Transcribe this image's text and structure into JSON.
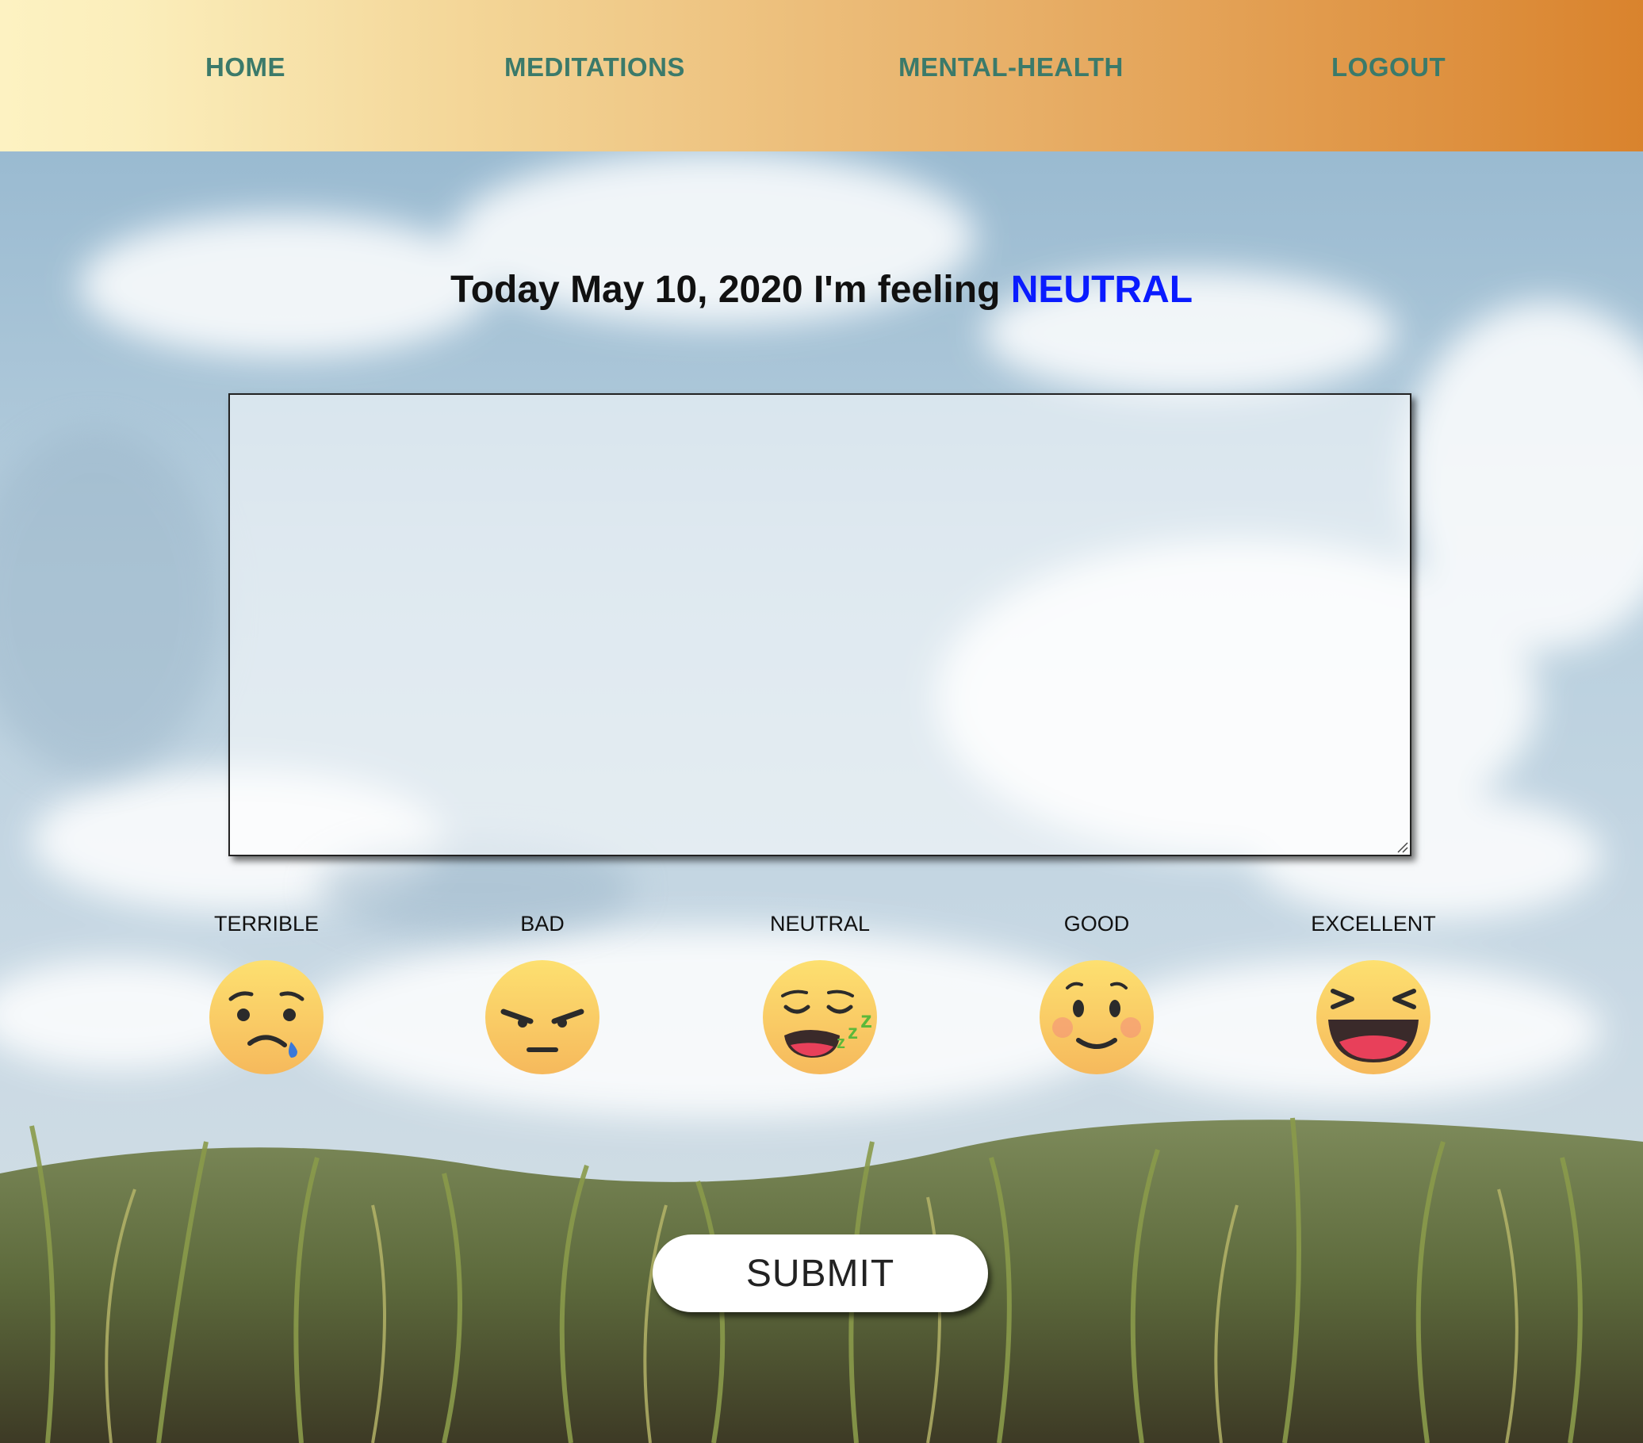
{
  "nav": {
    "home": "HOME",
    "meditations": "MEDITATIONS",
    "mental_health": "MENTAL-HEALTH",
    "logout": "LOGOUT"
  },
  "heading": {
    "prefix": "Today May 10, 2020 I'm feeling",
    "mood": "NEUTRAL"
  },
  "journal": {
    "value": ""
  },
  "moods": [
    {
      "label": "TERRIBLE",
      "icon": "sad-tear-face-icon"
    },
    {
      "label": "BAD",
      "icon": "angry-face-icon"
    },
    {
      "label": "NEUTRAL",
      "icon": "sleepy-face-icon"
    },
    {
      "label": "GOOD",
      "icon": "smiling-face-icon"
    },
    {
      "label": "EXCELLENT",
      "icon": "laughing-face-icon"
    }
  ],
  "submit": {
    "label": "SUBMIT"
  },
  "colors": {
    "nav_text": "#3b7a6a",
    "mood_highlight": "#0a1bff",
    "nav_gradient_start": "#fdf2c2",
    "nav_gradient_end": "#d9832d"
  }
}
